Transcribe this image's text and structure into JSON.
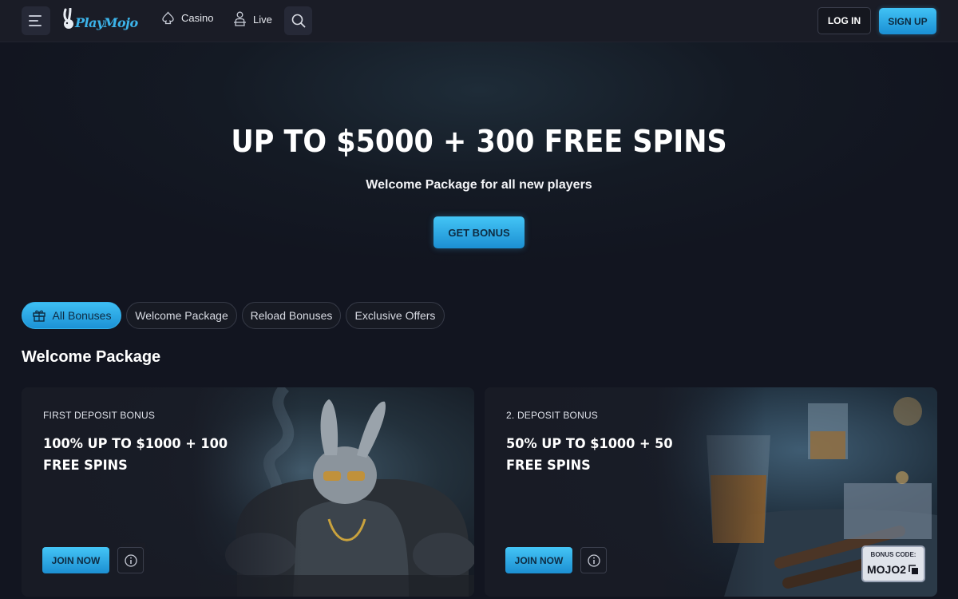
{
  "header": {
    "logo_text": "PlayMojo",
    "nav": [
      {
        "label": "Casino",
        "icon": "spade-icon"
      },
      {
        "label": "Live",
        "icon": "dealer-icon"
      }
    ],
    "login_label": "LOG IN",
    "signup_label": "SIGN UP"
  },
  "hero": {
    "title": "UP TO $5000 + 300 FREE SPINS",
    "subtitle": "Welcome Package for all new players",
    "cta_label": "GET BONUS"
  },
  "filters": [
    {
      "label": "All Bonuses",
      "active": true,
      "icon": "gift-icon"
    },
    {
      "label": "Welcome Package",
      "active": false
    },
    {
      "label": "Reload Bonuses",
      "active": false
    },
    {
      "label": "Exclusive Offers",
      "active": false
    }
  ],
  "section_title": "Welcome Package",
  "cards": [
    {
      "label": "FIRST DEPOSIT BONUS",
      "title": "100% UP TO $1000 + 100 FREE SPINS",
      "join_label": "JOIN NOW"
    },
    {
      "label": "2. DEPOSIT BONUS",
      "title": "50% UP TO $1000 + 50 FREE SPINS",
      "join_label": "JOIN NOW",
      "bonus_code_label": "BONUS CODE:",
      "bonus_code": "MOJO2"
    }
  ],
  "colors": {
    "accent": "#2fb0ee",
    "background": "#121520",
    "header": "#1a1c26"
  }
}
